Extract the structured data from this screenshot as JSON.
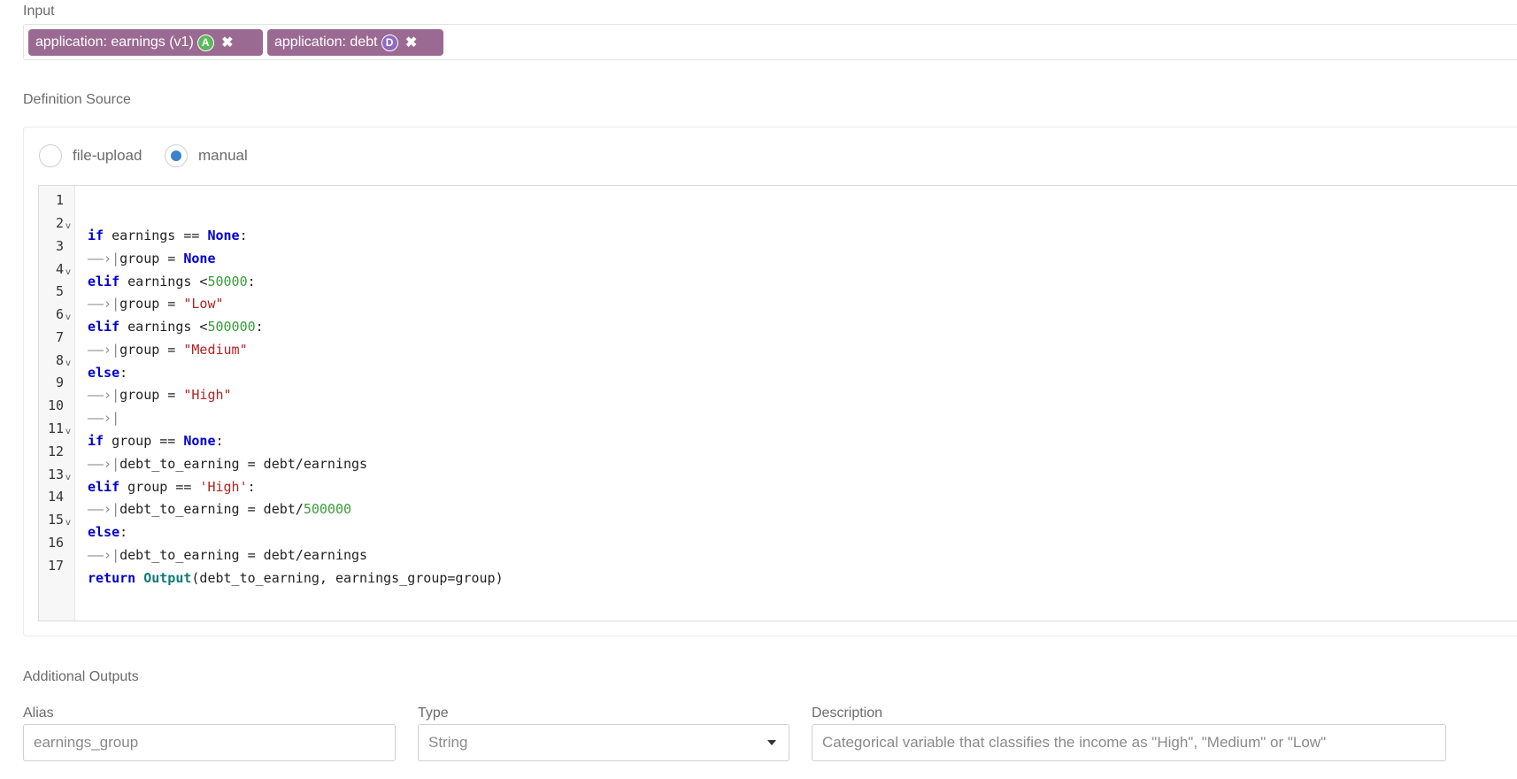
{
  "input": {
    "label": "Input",
    "tags": [
      {
        "text": "application: earnings (v1)",
        "badge": "A"
      },
      {
        "text": "application: debt",
        "badge": "D"
      }
    ]
  },
  "definition_source": {
    "label": "Definition Source",
    "options": [
      "file-upload",
      "manual"
    ],
    "selected": "manual"
  },
  "code": {
    "line_numbers": [
      "1",
      "2",
      "3",
      "4",
      "5",
      "6",
      "7",
      "8",
      "9",
      "10",
      "11",
      "12",
      "13",
      "14",
      "15",
      "16",
      "17"
    ]
  },
  "additional_outputs": {
    "label": "Additional Outputs",
    "alias": {
      "label": "Alias",
      "value": "earnings_group"
    },
    "type": {
      "label": "Type",
      "value": "String"
    },
    "description": {
      "label": "Description",
      "value": "Categorical variable that classifies the income as \"High\", \"Medium\" or \"Low\""
    }
  }
}
